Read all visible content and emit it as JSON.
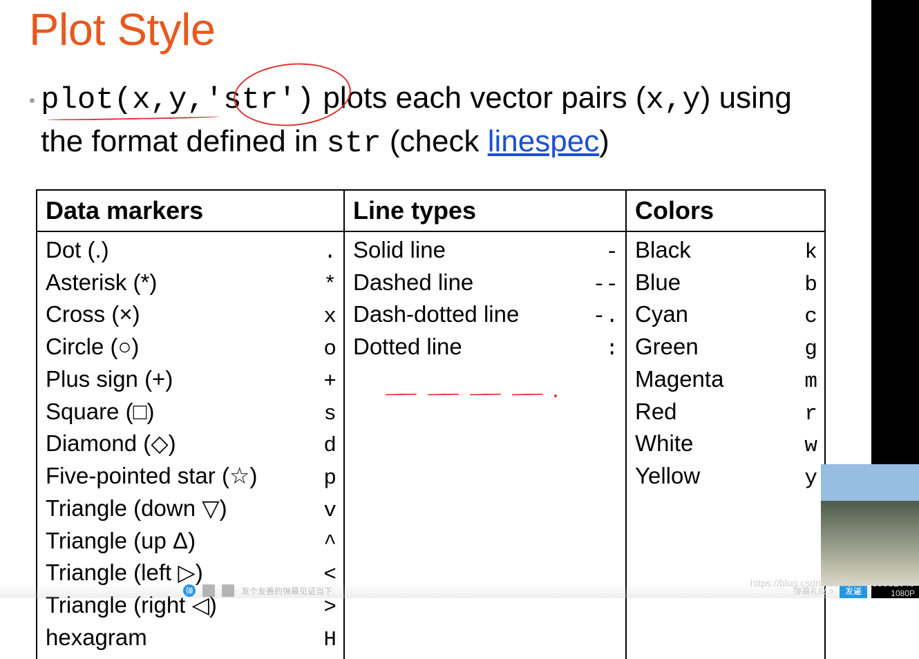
{
  "slide": {
    "title": "Plot Style",
    "bullet": {
      "code_prefix": "plot(x,y,",
      "code_arg": "'str'",
      "code_suffix": ")",
      "text_mid": " plots each vector pairs (",
      "code_xy": "x,y",
      "text_after_xy": ") using the format defined in ",
      "code_str": "str",
      "text_check_open": " (check ",
      "link_text": "linespec",
      "text_check_close": ")"
    },
    "table": {
      "markers_header": "Data markers",
      "linetypes_header": "Line types",
      "colors_header": "Colors",
      "markers": [
        {
          "label": "Dot (.)",
          "code": "."
        },
        {
          "label": "Asterisk (*)",
          "code": "*"
        },
        {
          "label": "Cross (×)",
          "code": "x"
        },
        {
          "label": "Circle (○)",
          "code": "o"
        },
        {
          "label": "Plus sign (+)",
          "code": "+"
        },
        {
          "label": "Square (□)",
          "code": "s"
        },
        {
          "label": "Diamond (◇)",
          "code": "d"
        },
        {
          "label": "Five-pointed star (☆)",
          "code": "p"
        },
        {
          "label": "Triangle (down ▽)",
          "code": "v"
        },
        {
          "label": "Triangle (up Δ)",
          "code": "^"
        },
        {
          "label": "Triangle (left ▷)",
          "code": "<"
        },
        {
          "label": "Triangle (right ◁)",
          "code": ">"
        },
        {
          "label": "hexagram",
          "code": "H"
        }
      ],
      "linetypes": [
        {
          "label": "Solid line",
          "code": "-"
        },
        {
          "label": "Dashed line",
          "code": "--"
        },
        {
          "label": "Dash-dotted line",
          "code": "-."
        },
        {
          "label": "Dotted line",
          "code": ":"
        }
      ],
      "colors": [
        {
          "label": "Black",
          "code": "k"
        },
        {
          "label": "Blue",
          "code": "b"
        },
        {
          "label": "Cyan",
          "code": "c"
        },
        {
          "label": "Green",
          "code": "g"
        },
        {
          "label": "Magenta",
          "code": "m"
        },
        {
          "label": "Red",
          "code": "r"
        },
        {
          "label": "White",
          "code": "w"
        },
        {
          "label": "Yellow",
          "code": "y"
        }
      ]
    }
  },
  "player": {
    "danmu_badge": "弹",
    "danmu_placeholder": "发个友善的弹幕见证当下",
    "gift_label": "弹幕礼仪 >",
    "send_label": "发送",
    "quality_label": "1080P"
  },
  "watermark": "https://blog.csdn.net/weixin_38331049"
}
